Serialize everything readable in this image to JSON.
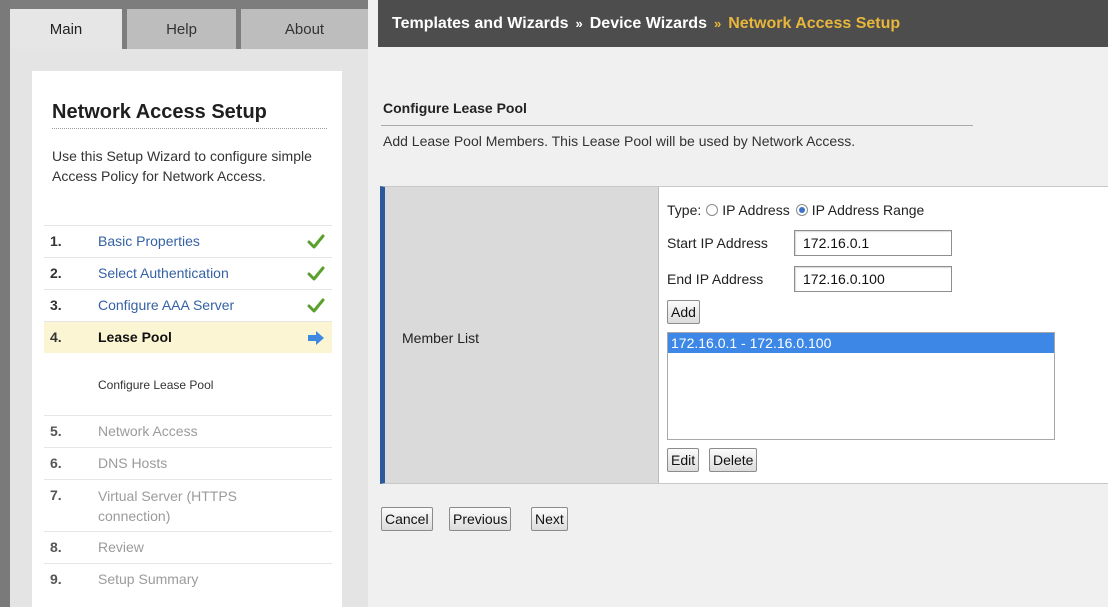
{
  "tabs": [
    {
      "label": "Main",
      "active": true
    },
    {
      "label": "Help",
      "active": false
    },
    {
      "label": "About",
      "active": false
    }
  ],
  "breadcrumb": {
    "items": [
      "Templates and Wizards",
      "Device Wizards",
      "Network Access Setup"
    ],
    "separator": "»"
  },
  "wizard": {
    "title": "Network Access Setup",
    "description": "Use this Setup Wizard to configure simple Access Policy for Network Access.",
    "steps": [
      {
        "num": "1.",
        "label": "Basic Properties",
        "state": "done",
        "icon": "check-icon"
      },
      {
        "num": "2.",
        "label": "Select Authentication",
        "state": "done",
        "icon": "check-icon"
      },
      {
        "num": "3.",
        "label": "Configure AAA Server",
        "state": "done",
        "icon": "check-icon"
      },
      {
        "num": "4.",
        "label": "Lease Pool",
        "state": "current",
        "icon": "arrow-right-icon"
      },
      {
        "num": "5.",
        "label": "Network Access",
        "state": "future"
      },
      {
        "num": "6.",
        "label": "DNS Hosts",
        "state": "future"
      },
      {
        "num": "7.",
        "label": "Virtual Server (HTTPS connection)",
        "state": "future"
      },
      {
        "num": "8.",
        "label": "Review",
        "state": "future"
      },
      {
        "num": "9.",
        "label": "Setup Summary",
        "state": "future"
      }
    ],
    "sub_step": "Configure Lease Pool"
  },
  "main": {
    "section_title": "Configure Lease Pool",
    "section_desc": "Add Lease Pool Members. This Lease Pool will be used by Network Access.",
    "member_list_label": "Member List",
    "type_label": "Type:",
    "type_options": [
      {
        "label": "IP Address",
        "checked": false
      },
      {
        "label": "IP Address Range",
        "checked": true
      }
    ],
    "start_ip_label": "Start IP Address",
    "start_ip_value": "172.16.0.1",
    "end_ip_label": "End IP Address",
    "end_ip_value": "172.16.0.100",
    "add_label": "Add",
    "members": [
      "172.16.0.1 - 172.16.0.100"
    ],
    "edit_label": "Edit",
    "delete_label": "Delete"
  },
  "footer_buttons": {
    "cancel": "Cancel",
    "previous": "Previous",
    "next": "Next"
  },
  "colors": {
    "accent_blue": "#2d5a9b",
    "breadcrumb_current": "#e8b63a",
    "selection": "#3d88e6",
    "check_green": "#5aa02c",
    "arrow_blue": "#3f8ae0"
  }
}
